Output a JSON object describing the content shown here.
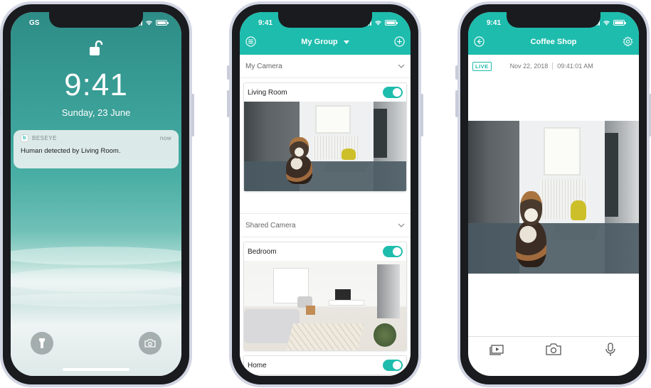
{
  "lock_screen": {
    "carrier": "GS",
    "time": "9:41",
    "date": "Sunday, 23 June",
    "notification": {
      "app": "BESEYE",
      "time": "now",
      "message": "Human detected by Living Room."
    },
    "icons": [
      "unlock-icon",
      "flashlight-icon",
      "camera-icon"
    ]
  },
  "group_screen": {
    "status_time": "9:41",
    "title": "My Group",
    "sections": [
      {
        "header": "My Camera",
        "cameras": [
          {
            "name": "Living Room",
            "enabled": true
          }
        ]
      },
      {
        "header": "Shared Camera",
        "cameras": [
          {
            "name": "Bedroom",
            "enabled": true
          },
          {
            "name": "Home",
            "enabled": true
          }
        ]
      }
    ]
  },
  "live_screen": {
    "status_time": "9:41",
    "title": "Coffee Shop",
    "live_badge": "LIVE",
    "date": "Nov 22, 2018",
    "time": "09:41:01 AM",
    "bottom_actions": [
      "playback-icon",
      "snapshot-icon",
      "microphone-icon"
    ]
  },
  "colors": {
    "accent": "#1ebcad",
    "phone_frame": "#d2d6e3"
  }
}
